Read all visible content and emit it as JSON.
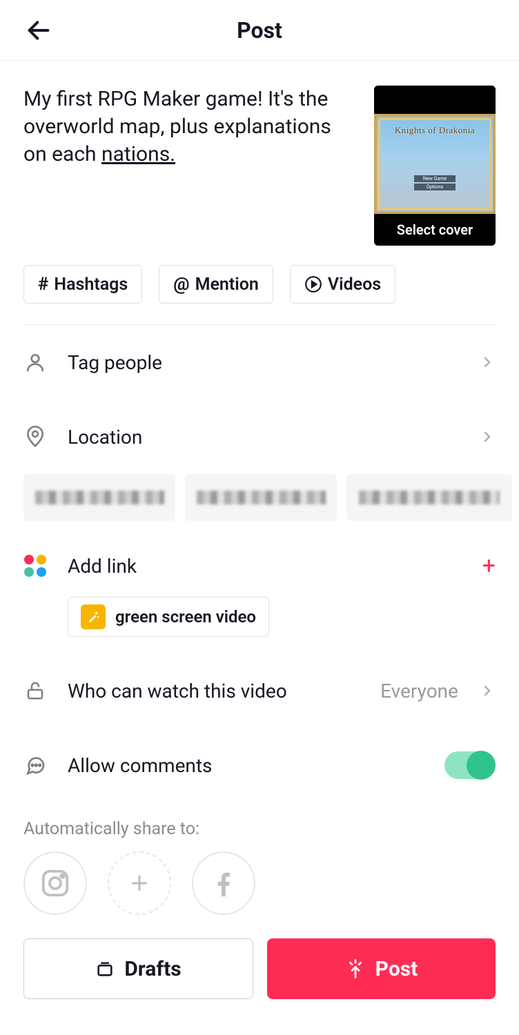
{
  "header": {
    "title": "Post"
  },
  "caption": {
    "prefix": "My first RPG Maker game! It's the overworld map, plus explanations on each ",
    "misspelled": "nations."
  },
  "cover": {
    "game_title": "Knights of Drakonia",
    "menu1": "New Game",
    "menu2": "Options",
    "footer": "Select cover"
  },
  "chips": {
    "hashtags": "Hashtags",
    "mention": "Mention",
    "videos": "Videos"
  },
  "rows": {
    "tag_people": "Tag people",
    "location": "Location",
    "add_link": "Add link",
    "effect_label": "green screen video",
    "privacy_label": "Who can watch this video",
    "privacy_value": "Everyone",
    "comments": "Allow comments"
  },
  "share": {
    "label": "Automatically share to:"
  },
  "buttons": {
    "drafts": "Drafts",
    "post": "Post"
  }
}
